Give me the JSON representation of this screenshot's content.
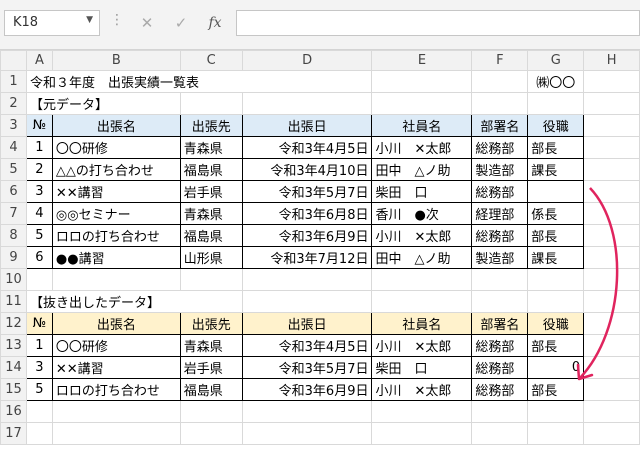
{
  "name_box": "K18",
  "formula_buttons": {
    "cancel": "✕",
    "enter": "✓",
    "fx": "fx"
  },
  "columns": [
    "A",
    "B",
    "C",
    "D",
    "E",
    "F",
    "G",
    "H"
  ],
  "title": "令和３年度　出張実績一覧表",
  "company": "㈱〇〇",
  "section1_label": "【元データ】",
  "section2_label": "【抜き出したデータ】",
  "headers": [
    "№",
    "出張名",
    "出張先",
    "出張日",
    "社員名",
    "部署名",
    "役職"
  ],
  "source_rows": [
    [
      "1",
      "〇〇研修",
      "青森県",
      "令和3年4月5日",
      "小川　✕太郎",
      "総務部",
      "部長"
    ],
    [
      "2",
      "△△の打ち合わせ",
      "福島県",
      "令和3年4月10日",
      "田中　△ノ助",
      "製造部",
      "課長"
    ],
    [
      "3",
      "✕✕講習",
      "岩手県",
      "令和3年5月7日",
      "柴田　口",
      "総務部",
      ""
    ],
    [
      "4",
      "◎◎セミナー",
      "青森県",
      "令和3年6月8日",
      "香川　●次",
      "経理部",
      "係長"
    ],
    [
      "5",
      "ロロの打ち合わせ",
      "福島県",
      "令和3年6月9日",
      "小川　✕太郎",
      "総務部",
      "部長"
    ],
    [
      "6",
      "●●講習",
      "山形県",
      "令和3年7月12日",
      "田中　△ノ助",
      "製造部",
      "課長"
    ]
  ],
  "extracted_rows": [
    [
      "1",
      "〇〇研修",
      "青森県",
      "令和3年4月5日",
      "小川　✕太郎",
      "総務部",
      "部長"
    ],
    [
      "3",
      "✕✕講習",
      "岩手県",
      "令和3年5月7日",
      "柴田　口",
      "総務部",
      "0"
    ],
    [
      "5",
      "ロロの打ち合わせ",
      "福島県",
      "令和3年6月9日",
      "小川　✕太郎",
      "総務部",
      "部長"
    ]
  ],
  "row_numbers": [
    "1",
    "2",
    "3",
    "4",
    "5",
    "6",
    "7",
    "8",
    "9",
    "10",
    "11",
    "12",
    "13",
    "14",
    "15",
    "16",
    "17"
  ],
  "accent_color": "#e0245e"
}
